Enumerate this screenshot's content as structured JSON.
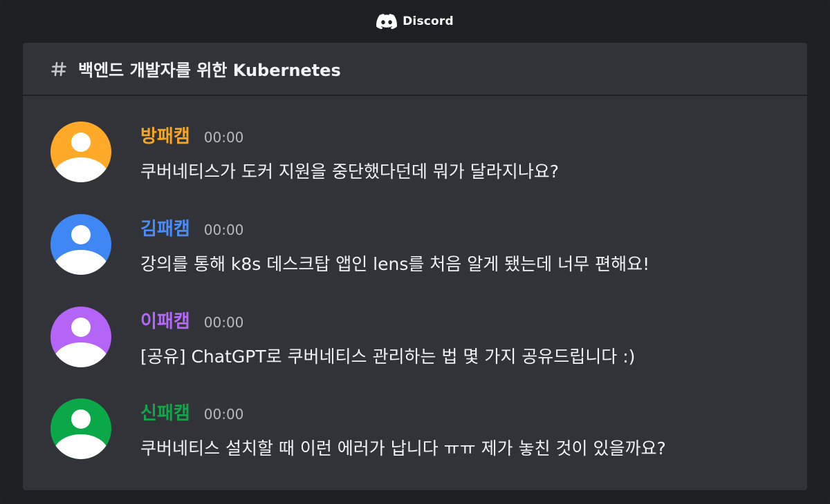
{
  "app": {
    "name": "Discord",
    "logo_icon": "discord-logo-icon"
  },
  "channel": {
    "icon": "hash-icon",
    "name": "백엔드 개발자를 위한 Kubernetes"
  },
  "messages": [
    {
      "username": "방패캠",
      "time": "00:00",
      "text": "쿠버네티스가 도커 지원을 중단했다던데 뭐가 달라지나요?",
      "color": "#f5a623",
      "avatar_color": "#ffa928"
    },
    {
      "username": "김패캠",
      "time": "00:00",
      "text": "강의를 통해 k8s 데스크탑 앱인 lens를 처음 알게 됐는데 너무 편해요!",
      "color": "#4b8df8",
      "avatar_color": "#3f87f5"
    },
    {
      "username": "이패캠",
      "time": "00:00",
      "text": "[공유] ChatGPT로 쿠버네티스 관리하는 법 몇 가지 공유드립니다 :)",
      "color": "#b369f5",
      "avatar_color": "#b464f6"
    },
    {
      "username": "신패캠",
      "time": "00:00",
      "text": "쿠버네티스 설치할 때 이런 에러가 납니다 ㅠㅠ 제가 놓친 것이 있을까요?",
      "color": "#16a34a",
      "avatar_color": "#0ba84a"
    }
  ]
}
